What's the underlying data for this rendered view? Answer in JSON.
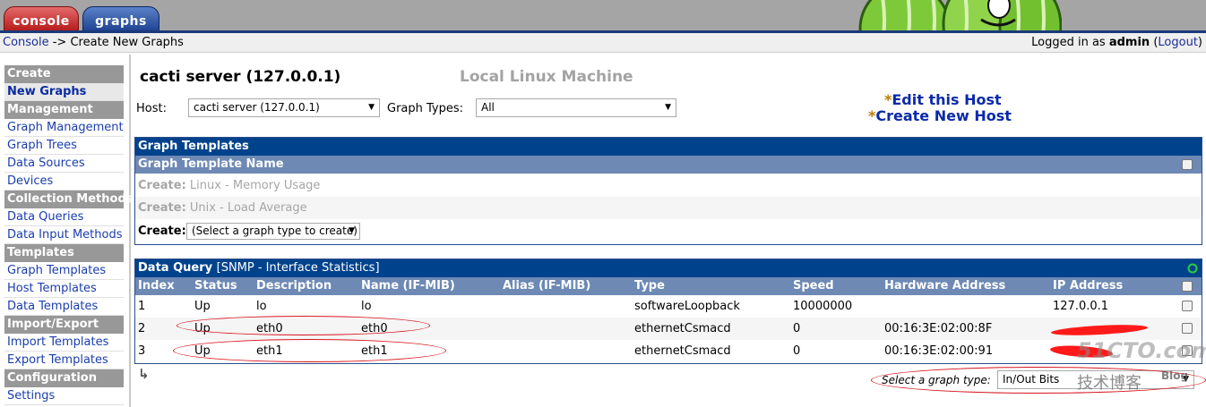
{
  "tabs": {
    "console": "console",
    "graphs": "graphs"
  },
  "breadcrumb": {
    "root": "Console",
    "sep": " -> ",
    "current": "Create New Graphs"
  },
  "login": {
    "prefix": "Logged in as ",
    "user": "admin",
    "open": " (",
    "logout": "Logout",
    "close": ")"
  },
  "sidebar": [
    {
      "type": "head",
      "label": "Create"
    },
    {
      "type": "item",
      "label": "New Graphs",
      "active": true
    },
    {
      "type": "head",
      "label": "Management"
    },
    {
      "type": "item",
      "label": "Graph Management"
    },
    {
      "type": "item",
      "label": "Graph Trees"
    },
    {
      "type": "item",
      "label": "Data Sources"
    },
    {
      "type": "item",
      "label": "Devices"
    },
    {
      "type": "head",
      "label": "Collection Methods"
    },
    {
      "type": "item",
      "label": "Data Queries"
    },
    {
      "type": "item",
      "label": "Data Input Methods"
    },
    {
      "type": "head",
      "label": "Templates"
    },
    {
      "type": "item",
      "label": "Graph Templates"
    },
    {
      "type": "item",
      "label": "Host Templates"
    },
    {
      "type": "item",
      "label": "Data Templates"
    },
    {
      "type": "head",
      "label": "Import/Export"
    },
    {
      "type": "item",
      "label": "Import Templates"
    },
    {
      "type": "item",
      "label": "Export Templates"
    },
    {
      "type": "head",
      "label": "Configuration"
    },
    {
      "type": "item",
      "label": "Settings"
    }
  ],
  "host": {
    "title": "cacti server (127.0.0.1)",
    "description": "Local Linux Machine",
    "host_label": "Host:",
    "host_value": "cacti server (127.0.0.1)",
    "types_label": "Graph Types:",
    "types_value": "All",
    "edit_link": "Edit this Host",
    "create_link": "Create New Host",
    "star": "*"
  },
  "graph_templates": {
    "title": "Graph Templates",
    "col": "Graph Template Name",
    "rows": [
      {
        "prefix": "Create:",
        "name": "Linux - Memory Usage"
      },
      {
        "prefix": "Create:",
        "name": "Unix - Load Average"
      }
    ],
    "create_label": "Create:",
    "create_value": "(Select a graph type to create)"
  },
  "data_query": {
    "title": "Data Query",
    "name": "[SNMP - Interface Statistics]",
    "columns": [
      "Index",
      "Status",
      "Description",
      "Name (IF-MIB)",
      "Alias (IF-MIB)",
      "Type",
      "Speed",
      "Hardware Address",
      "IP Address"
    ],
    "rows": [
      [
        "1",
        "Up",
        "lo",
        "lo",
        "",
        "softwareLoopback",
        "10000000",
        "",
        "127.0.0.1"
      ],
      [
        "2",
        "Up",
        "eth0",
        "eth0",
        "",
        "ethernetCsmacd",
        "0",
        "00:16:3E:02:00:8F",
        ""
      ],
      [
        "3",
        "Up",
        "eth1",
        "eth1",
        "",
        "ethernetCsmacd",
        "0",
        "00:16:3E:02:00:91",
        ""
      ]
    ],
    "select_label": "Select a graph type:",
    "select_value": "In/Out Bits"
  },
  "watermark": {
    "site": "51CTO.com",
    "cn": "技术博客",
    "blog": "Blog"
  },
  "colors": {
    "header": "#00438c",
    "subheader": "#6d89b4",
    "sidebar_head": "#989898",
    "link": "#1a3dad",
    "annotation": "#d8141d"
  }
}
